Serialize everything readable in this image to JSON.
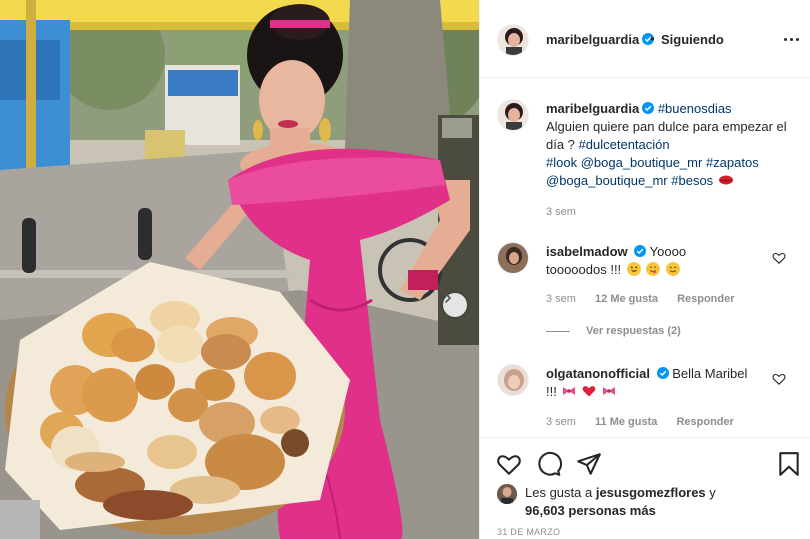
{
  "post": {
    "author": "maribelguardia",
    "separator": "•",
    "follow_label": "Siguiendo"
  },
  "caption": {
    "username": "maribelguardia",
    "lead_hashtag": "#buenosdias",
    "text_1": "Alguien quiere pan dulce para empezar el día ?",
    "hashtag_2": "#dulcetentación",
    "hashtag_3": "#look",
    "mention_1": "@boga_boutique_mr",
    "hashtag_4": "#zapatos",
    "mention_2": "@boga_boutique_mr",
    "hashtag_5": "#besos",
    "time": "3 sem"
  },
  "comments": [
    {
      "username": "isabelmadow",
      "text_a": "Yoooo",
      "text_b": "tooooodos !!!",
      "time": "3 sem",
      "likes": "12 Me gusta",
      "reply": "Responder",
      "view_replies": "Ver respuestas (2)"
    },
    {
      "username": "olgatanonofficial",
      "text_a": "Bella Maribel",
      "text_b": "!!!",
      "time": "3 sem",
      "likes": "11 Me gusta",
      "reply": "Responder"
    }
  ],
  "likes": {
    "prefix": "Les gusta a",
    "liker": "jesusgomezflores",
    "conjunction": "y",
    "count": "96,603 personas más"
  },
  "date": "31 DE MARZO",
  "icons": [
    "heart-icon",
    "comment-icon",
    "share-icon",
    "save-icon",
    "verified-icon",
    "more-options-icon",
    "next-arrow-icon"
  ],
  "colors": {
    "accent_blue": "#00376b",
    "verified_blue": "#0095f6",
    "dress_pink": "#e0308a",
    "muted": "#8e8e8e"
  }
}
